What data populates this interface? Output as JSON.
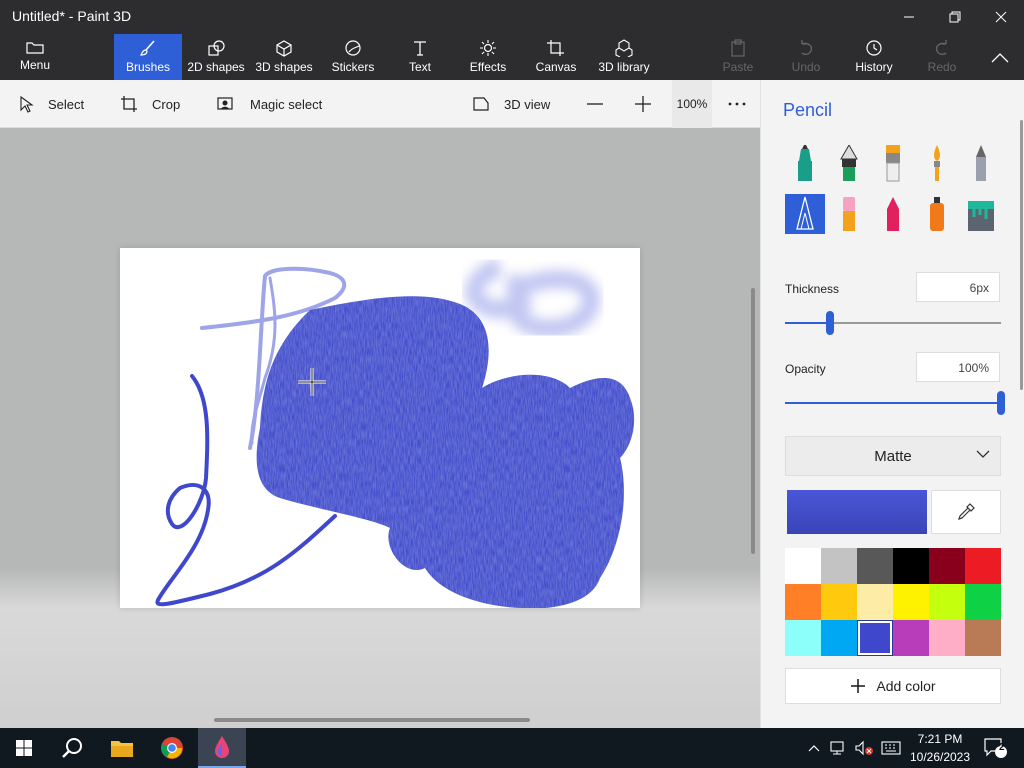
{
  "window": {
    "title": "Untitled* - Paint 3D"
  },
  "ribbon": {
    "menu": "Menu",
    "brushes": "Brushes",
    "shapes2d": "2D shapes",
    "shapes3d": "3D shapes",
    "stickers": "Stickers",
    "text": "Text",
    "effects": "Effects",
    "canvas": "Canvas",
    "library3d": "3D library",
    "paste": "Paste",
    "undo": "Undo",
    "history": "History",
    "redo": "Redo"
  },
  "toolbar": {
    "select": "Select",
    "crop": "Crop",
    "magic_select": "Magic select",
    "view3d": "3D view",
    "zoom": "100%"
  },
  "panel": {
    "title": "Pencil",
    "thickness_label": "Thickness",
    "thickness_value": "6px",
    "thickness_level": 0.21,
    "opacity_label": "Opacity",
    "opacity_value": "100%",
    "opacity_level": 1.0,
    "finish": "Matte",
    "add_color": "Add color",
    "current_color": "#4a56d6",
    "palette": [
      "#ffffff",
      "#c3c3c3",
      "#585858",
      "#000000",
      "#88001b",
      "#ec1c24",
      "#ff7f27",
      "#ffc90e",
      "#fdeca6",
      "#fff200",
      "#c4ff0e",
      "#0ed145",
      "#8cfffb",
      "#00a8f3",
      "#3f48cc",
      "#b83dba",
      "#ffaec8",
      "#b97a56"
    ],
    "palette_selected": 14,
    "tools": [
      "marker",
      "calligraphy-pen",
      "oil-brush",
      "watercolor",
      "pencil",
      "pixel-pen",
      "eraser",
      "crayon",
      "spray-can",
      "fill"
    ]
  },
  "taskbar": {
    "time": "7:21 PM",
    "date": "10/26/2023",
    "notifications": "2"
  }
}
